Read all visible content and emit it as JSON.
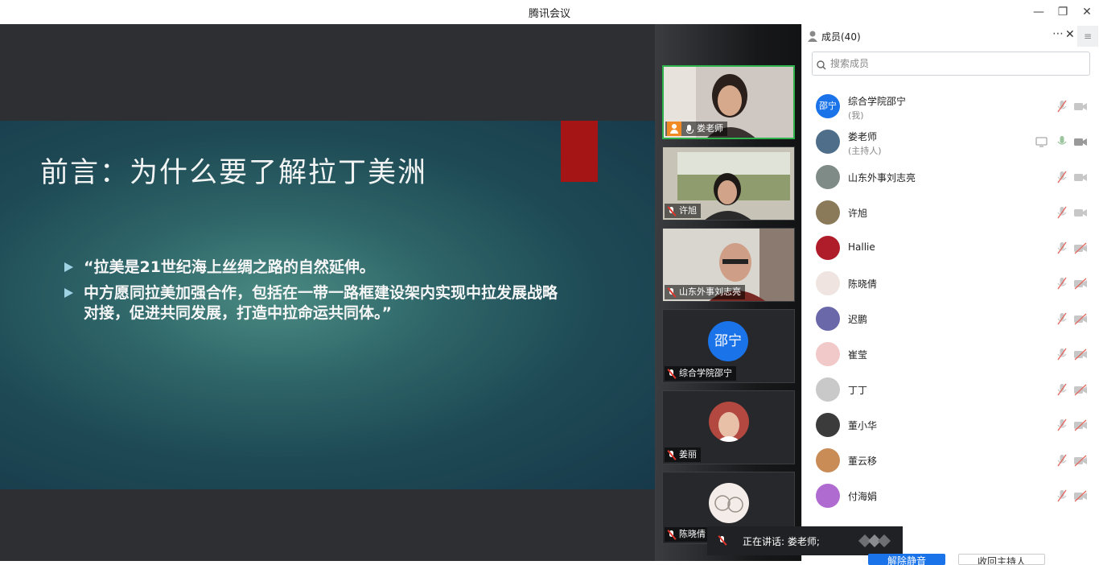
{
  "window": {
    "title": "腾讯会议"
  },
  "slide": {
    "title": "前言：为什么要了解拉丁美洲",
    "bullets": [
      "“拉美是21世纪海上丝绸之路的自然延伸。",
      "中方愿同拉美加强合作，包括在一带一路框建设架内实现中拉发展战略对接，促进共同发展，打造中拉命运共同体。”"
    ]
  },
  "video_tiles": [
    {
      "name": "娄老师",
      "mic": "on",
      "host": true
    },
    {
      "name": "许旭",
      "mic": "off"
    },
    {
      "name": "山东外事刘志亮",
      "mic": "off"
    },
    {
      "name": "综合学院邵宁",
      "mic": "off",
      "avatar_text": "邵宁"
    },
    {
      "name": "姜丽",
      "mic": "off"
    },
    {
      "name": "陈晓倩",
      "mic": "off"
    }
  ],
  "panel": {
    "header": "成员(40)",
    "search_placeholder": "搜索成员",
    "members": [
      {
        "name": "综合学院邵宁",
        "sub": "(我)",
        "avatar_text": "邵宁",
        "avatar_color": "#1a73e8"
      },
      {
        "name": "娄老师",
        "sub": "(主持人)",
        "avatar_color": "#4f6e8a"
      },
      {
        "name": "山东外事刘志亮",
        "avatar_color": "#7f8b86"
      },
      {
        "name": "许旭",
        "avatar_color": "#8a7a5a"
      },
      {
        "name": "Hallie",
        "avatar_color": "#b01d2a"
      },
      {
        "name": "陈晓倩",
        "avatar_color": "#efe4df"
      },
      {
        "name": "迟鹏",
        "avatar_color": "#6a68a8"
      },
      {
        "name": "崔莹",
        "avatar_color": "#f2c9c9"
      },
      {
        "name": "丁丁",
        "avatar_color": "#c9c9c9"
      },
      {
        "name": "董小华",
        "avatar_color": "#3b3b3b"
      },
      {
        "name": "董云移",
        "avatar_color": "#c98c57"
      },
      {
        "name": "付海娟",
        "avatar_color": "#b06bd0"
      }
    ]
  },
  "status": {
    "speaking": "正在讲话: 娄老师;"
  },
  "buttons": {
    "unmute_all": "解除静音",
    "reclaim_host": "收回主持人"
  }
}
